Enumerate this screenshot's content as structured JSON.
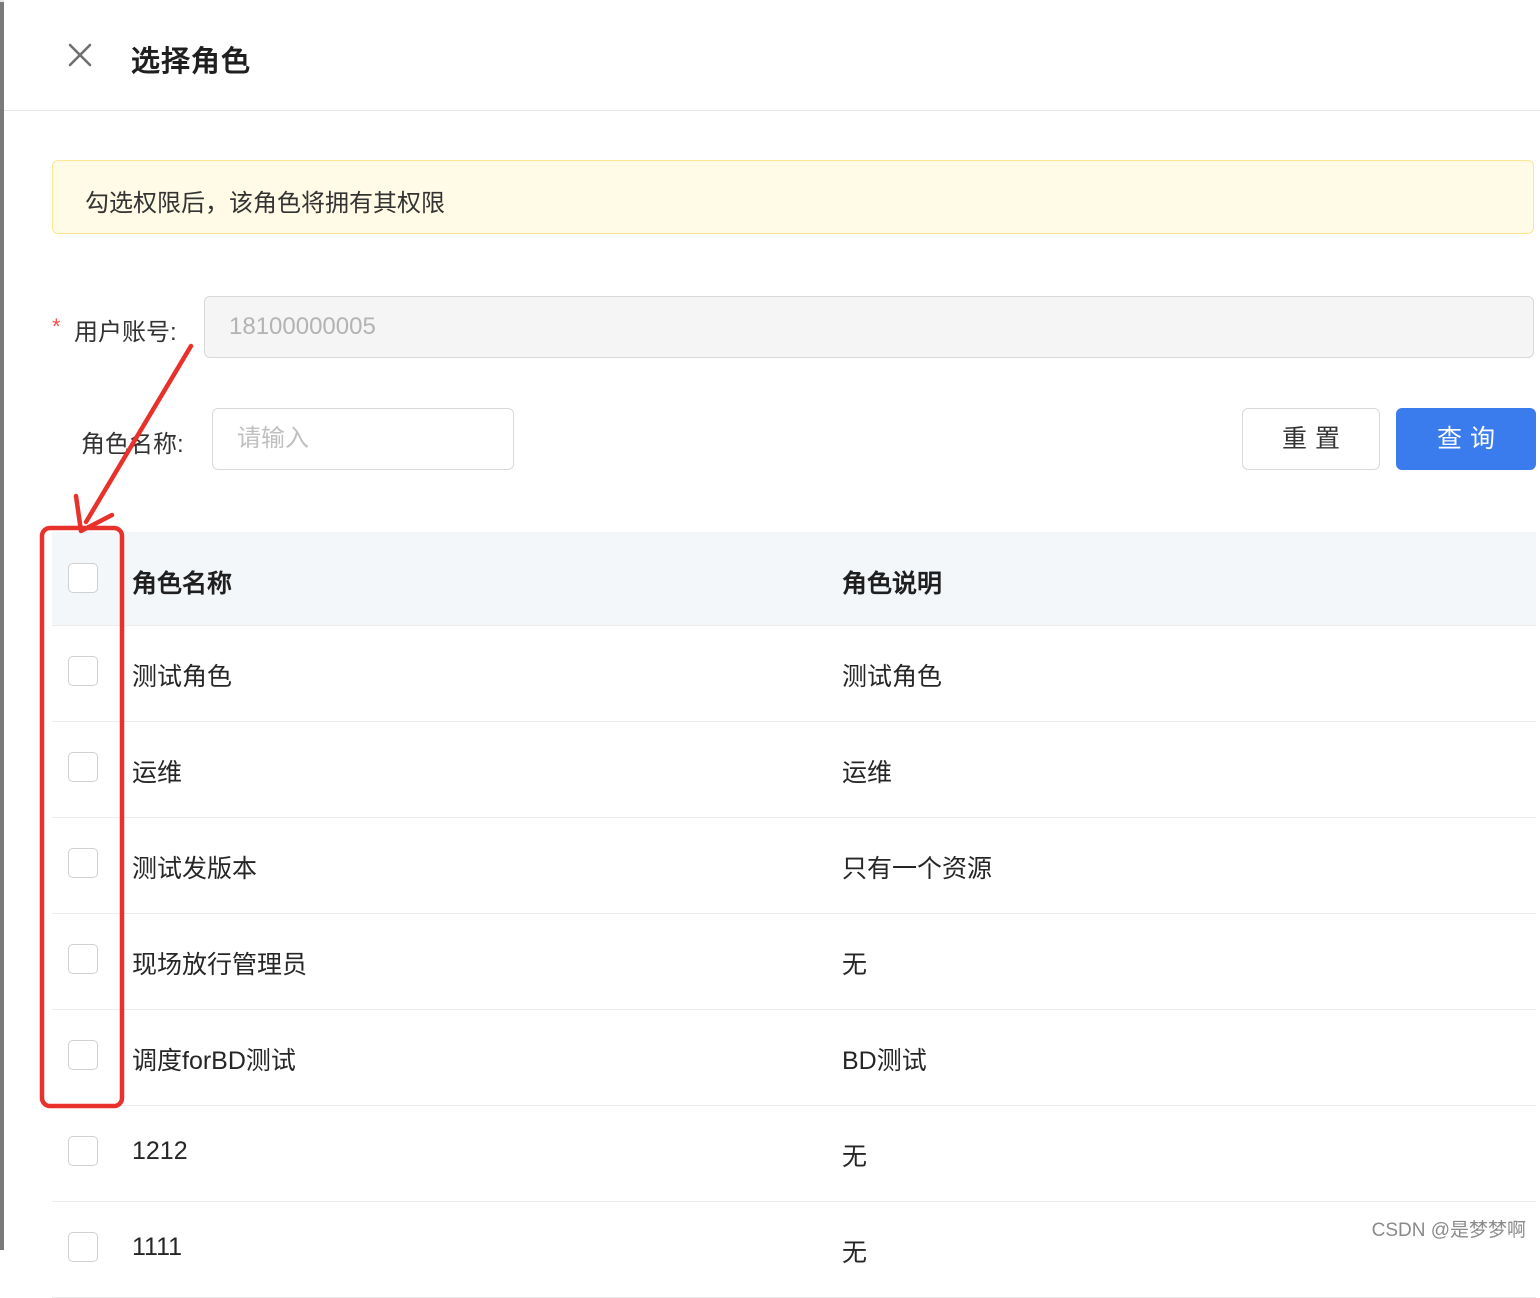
{
  "drawer": {
    "title": "选择角色"
  },
  "notice": {
    "text": "勾选权限后，该角色将拥有其权限"
  },
  "form": {
    "account": {
      "required_mark": "*",
      "label": "用户账号:",
      "value": "18100000005"
    },
    "role_name": {
      "label": "角色名称:",
      "placeholder": "请输入",
      "value": ""
    },
    "reset_label": "重置",
    "query_label": "查询"
  },
  "table": {
    "columns": [
      "角色名称",
      "角色说明"
    ],
    "rows": [
      {
        "name": "测试角色",
        "desc": "测试角色",
        "checked": false
      },
      {
        "name": "运维",
        "desc": "运维",
        "checked": false
      },
      {
        "name": "测试发版本",
        "desc": "只有一个资源",
        "checked": false
      },
      {
        "name": "现场放行管理员",
        "desc": "无",
        "checked": false
      },
      {
        "name": "调度forBD测试",
        "desc": "BD测试",
        "checked": false
      },
      {
        "name": "1212",
        "desc": "无",
        "checked": false
      },
      {
        "name": "1111",
        "desc": "无",
        "checked": false
      }
    ]
  },
  "annotation": {
    "color": "#e8312a"
  },
  "watermark": {
    "text": "CSDN @是梦梦啊"
  },
  "colors": {
    "primary": "#3a7bee",
    "warning_bg": "#fffbe6",
    "warning_border": "#ffe58f",
    "required": "#ff4d4f"
  },
  "icons": {
    "close": "close-icon"
  }
}
